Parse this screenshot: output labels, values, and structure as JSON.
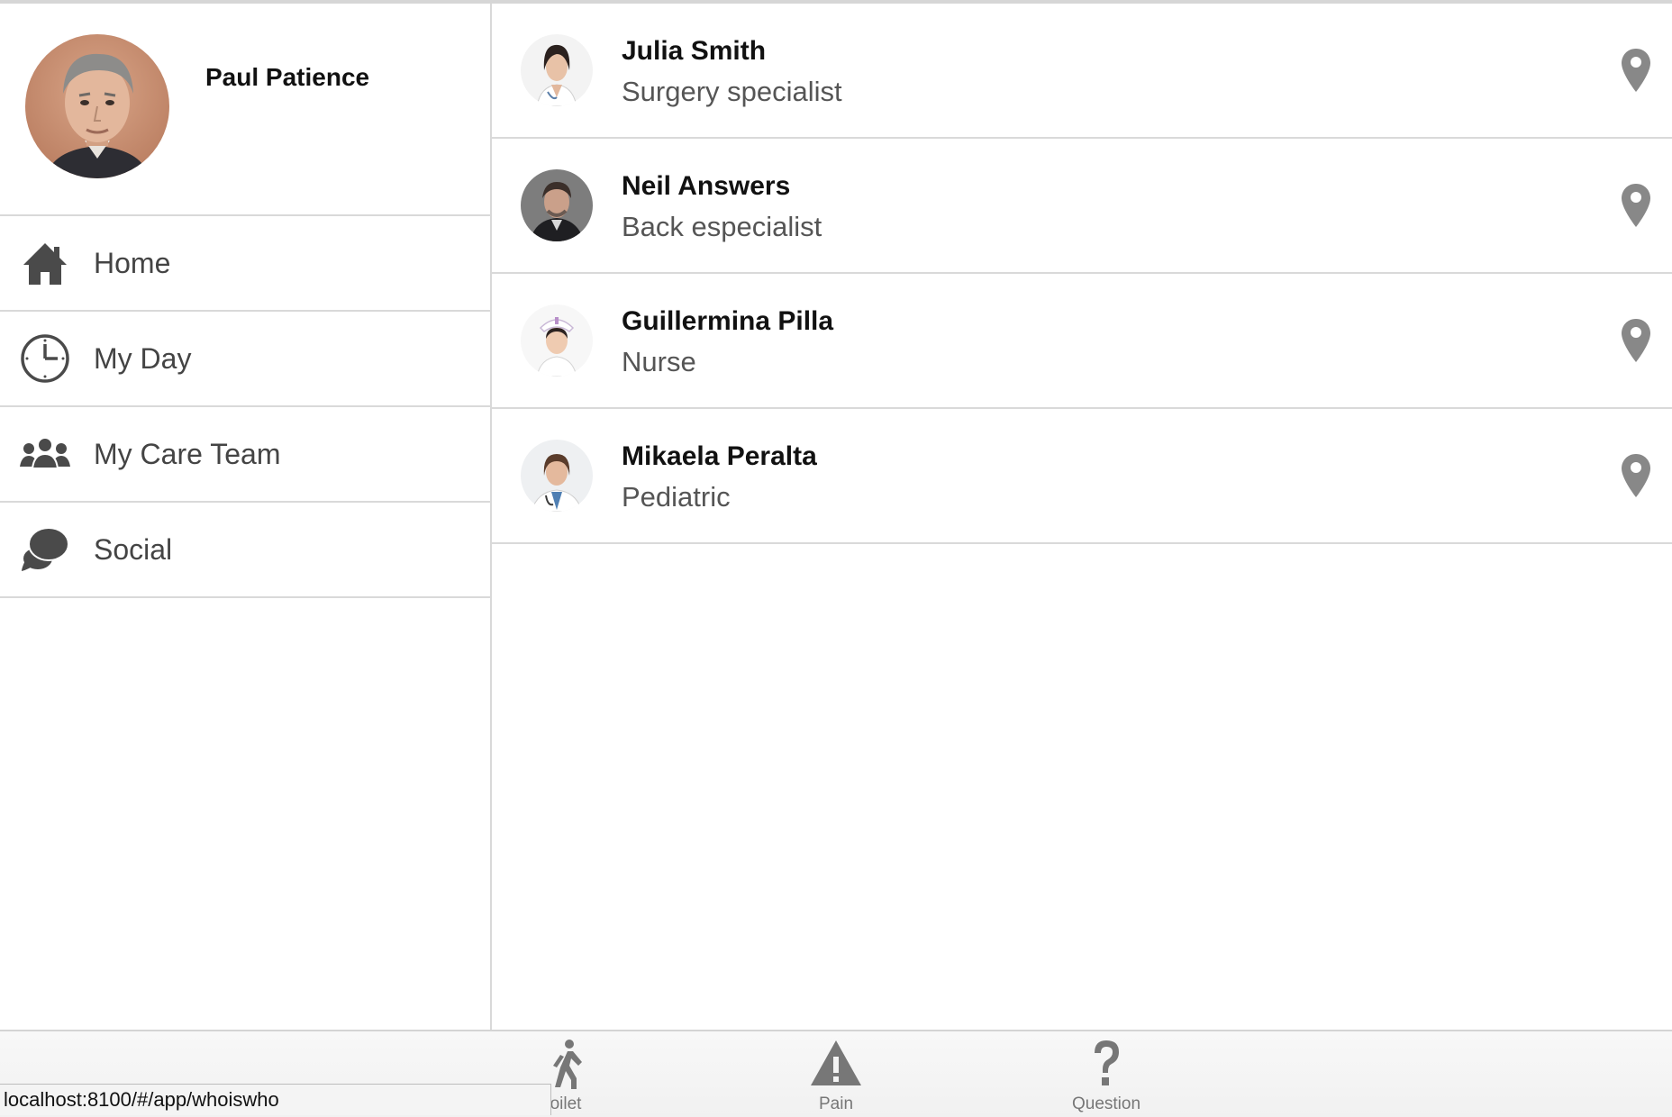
{
  "profile": {
    "name": "Paul Patience"
  },
  "sidebar": {
    "items": [
      {
        "label": "Home",
        "icon": "home-icon"
      },
      {
        "label": "My Day",
        "icon": "clock-icon"
      },
      {
        "label": "My Care Team",
        "icon": "group-icon"
      },
      {
        "label": "Social",
        "icon": "chat-bubbles-icon"
      }
    ]
  },
  "team": [
    {
      "name": "Julia Smith",
      "role": "Surgery specialist",
      "icon": "location-pin-icon"
    },
    {
      "name": "Neil Answers",
      "role": "Back especialist",
      "icon": "location-pin-icon"
    },
    {
      "name": "Guillermina Pilla",
      "role": "Nurse",
      "icon": "location-pin-icon"
    },
    {
      "name": "Mikaela Peralta",
      "role": "Pediatric",
      "icon": "location-pin-icon"
    }
  ],
  "tabbar": {
    "tabs": [
      {
        "label": "oilet",
        "icon": "walking-person-icon"
      },
      {
        "label": "Pain",
        "icon": "warning-triangle-icon"
      },
      {
        "label": "Question",
        "icon": "question-mark-icon"
      }
    ]
  },
  "status_bar": {
    "url": "localhost:8100/#/app/whoiswho"
  },
  "colors": {
    "icon": "#4a4a4a",
    "pin": "#888888",
    "divider": "#d9d9d9",
    "tab_label": "#777777"
  }
}
